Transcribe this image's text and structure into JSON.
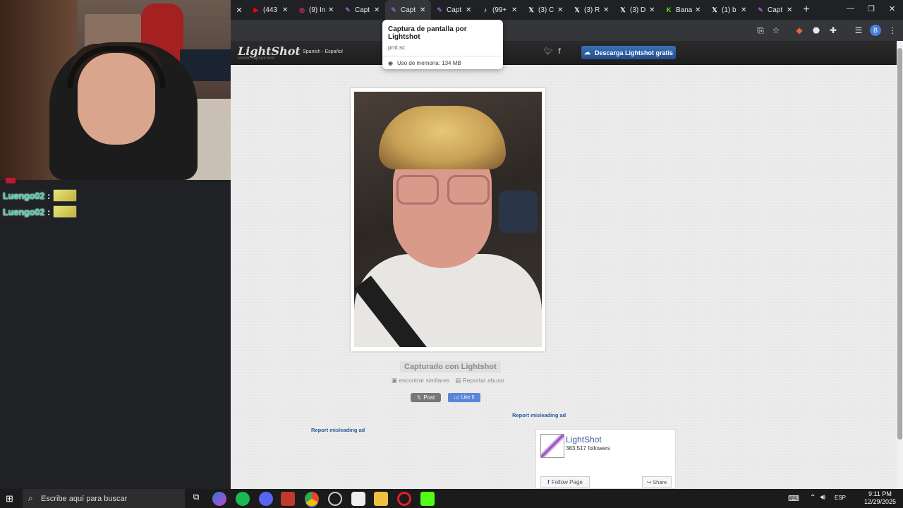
{
  "chat": {
    "lines": [
      {
        "username": "Luengo02",
        "colon": ":"
      },
      {
        "username": "Luengo02",
        "colon": ":"
      }
    ]
  },
  "tabs": [
    {
      "title": "(443",
      "icon": "youtube-icon",
      "color": "#ff0000"
    },
    {
      "title": "(9) In",
      "icon": "instagram-icon",
      "color": "#e1306c"
    },
    {
      "title": "Capt",
      "icon": "lightshot-feather-icon",
      "color": "#9b59b6"
    },
    {
      "title": "Capt",
      "icon": "lightshot-feather-icon",
      "color": "#9b59b6",
      "active": true
    },
    {
      "title": "Capt",
      "icon": "lightshot-feather-icon",
      "color": "#9b59b6"
    },
    {
      "title": "(99+",
      "icon": "tiktok-icon",
      "color": "#ffffff"
    },
    {
      "title": "(3) C",
      "icon": "x-icon",
      "color": "#ffffff"
    },
    {
      "title": "(3) R",
      "icon": "x-icon",
      "color": "#ffffff"
    },
    {
      "title": "(3) D",
      "icon": "x-icon",
      "color": "#ffffff"
    },
    {
      "title": "Bana",
      "icon": "kick-icon",
      "color": "#53fc18"
    },
    {
      "title": "(1) b",
      "icon": "x-icon",
      "color": "#ffffff"
    },
    {
      "title": "Capt",
      "icon": "lightshot-feather-icon",
      "color": "#9b59b6"
    }
  ],
  "tooltip": {
    "title": "Captura de pantalla por Lightshot",
    "domain": "prnt.sc",
    "memory": "Uso de memoria: 134 MB"
  },
  "lightshot": {
    "logo": "LightShot",
    "logo_sub": "screen capture tool",
    "language": "Spanish - Español",
    "download_button": "Descarga Lightshot gratis",
    "caption": "Capturado con Lightshot",
    "find_similar": "encontrar similares",
    "report_abuse": "Reportar abuso",
    "x_post": "Post",
    "fb_like": "Like 0",
    "report_ad_1": "Report misleading ad",
    "report_ad_2": "Report misleading ad"
  },
  "fb_widget": {
    "name": "LightShot",
    "followers": "383,517 followers",
    "follow_button": "Follow Page",
    "share_button": "Share"
  },
  "taskbar": {
    "search_placeholder": "Escribe aquí para buscar",
    "language": "ESP",
    "time": "9:11 PM",
    "date": "12/29/2025"
  },
  "colors": {
    "accent": "#3b6fb8",
    "chat_name": "#3fd2a0",
    "tab_bg": "#202124",
    "toolbar_bg": "#35363a"
  }
}
